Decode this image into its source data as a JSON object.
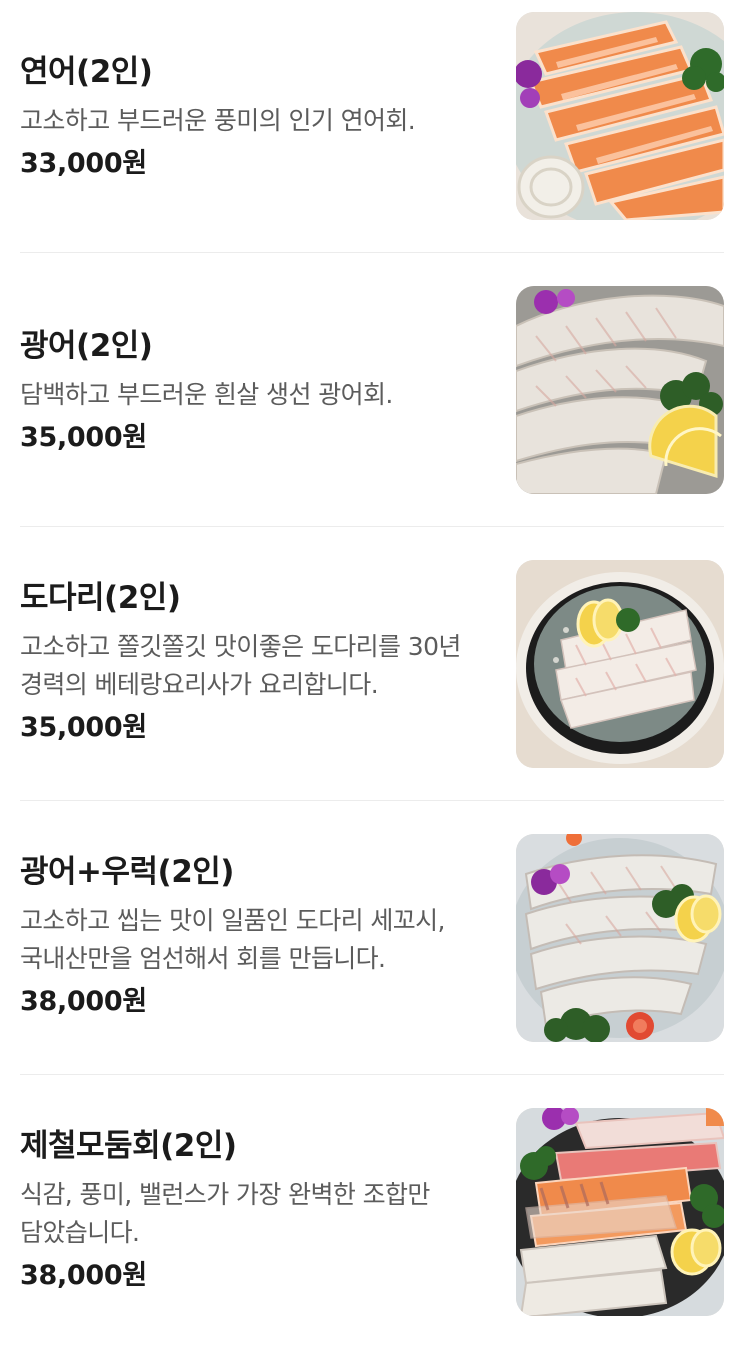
{
  "menu": {
    "items": [
      {
        "name": "연어(2인)",
        "description": "고소하고 부드러운 풍미의 인기 연어회.",
        "price": "33,000원",
        "image_icon": "salmon-sashimi-photo"
      },
      {
        "name": "광어(2인)",
        "description": "담백하고 부드러운 흰살 생선 광어회.",
        "price": "35,000원",
        "image_icon": "flatfish-sashimi-photo"
      },
      {
        "name": "도다리(2인)",
        "description": "고소하고 쫄깃쫄깃 맛이좋은 도다리를 30년 경력의 베테랑요리사가 요리합니다.",
        "price": "35,000원",
        "image_icon": "flounder-sashimi-photo"
      },
      {
        "name": "광어+우럭(2인)",
        "description": "고소하고 씹는 맛이 일품인 도다리 세꼬시, 국내산만을 엄선해서 회를 만듭니다.",
        "price": "38,000원",
        "image_icon": "flatfish-rockfish-sashimi-photo"
      },
      {
        "name": "제철모둠회(2인)",
        "description": "식감, 풍미, 밸런스가 가장 완벽한 조합만 담았습니다.",
        "price": "38,000원",
        "image_icon": "seasonal-assorted-sashimi-photo"
      }
    ]
  }
}
